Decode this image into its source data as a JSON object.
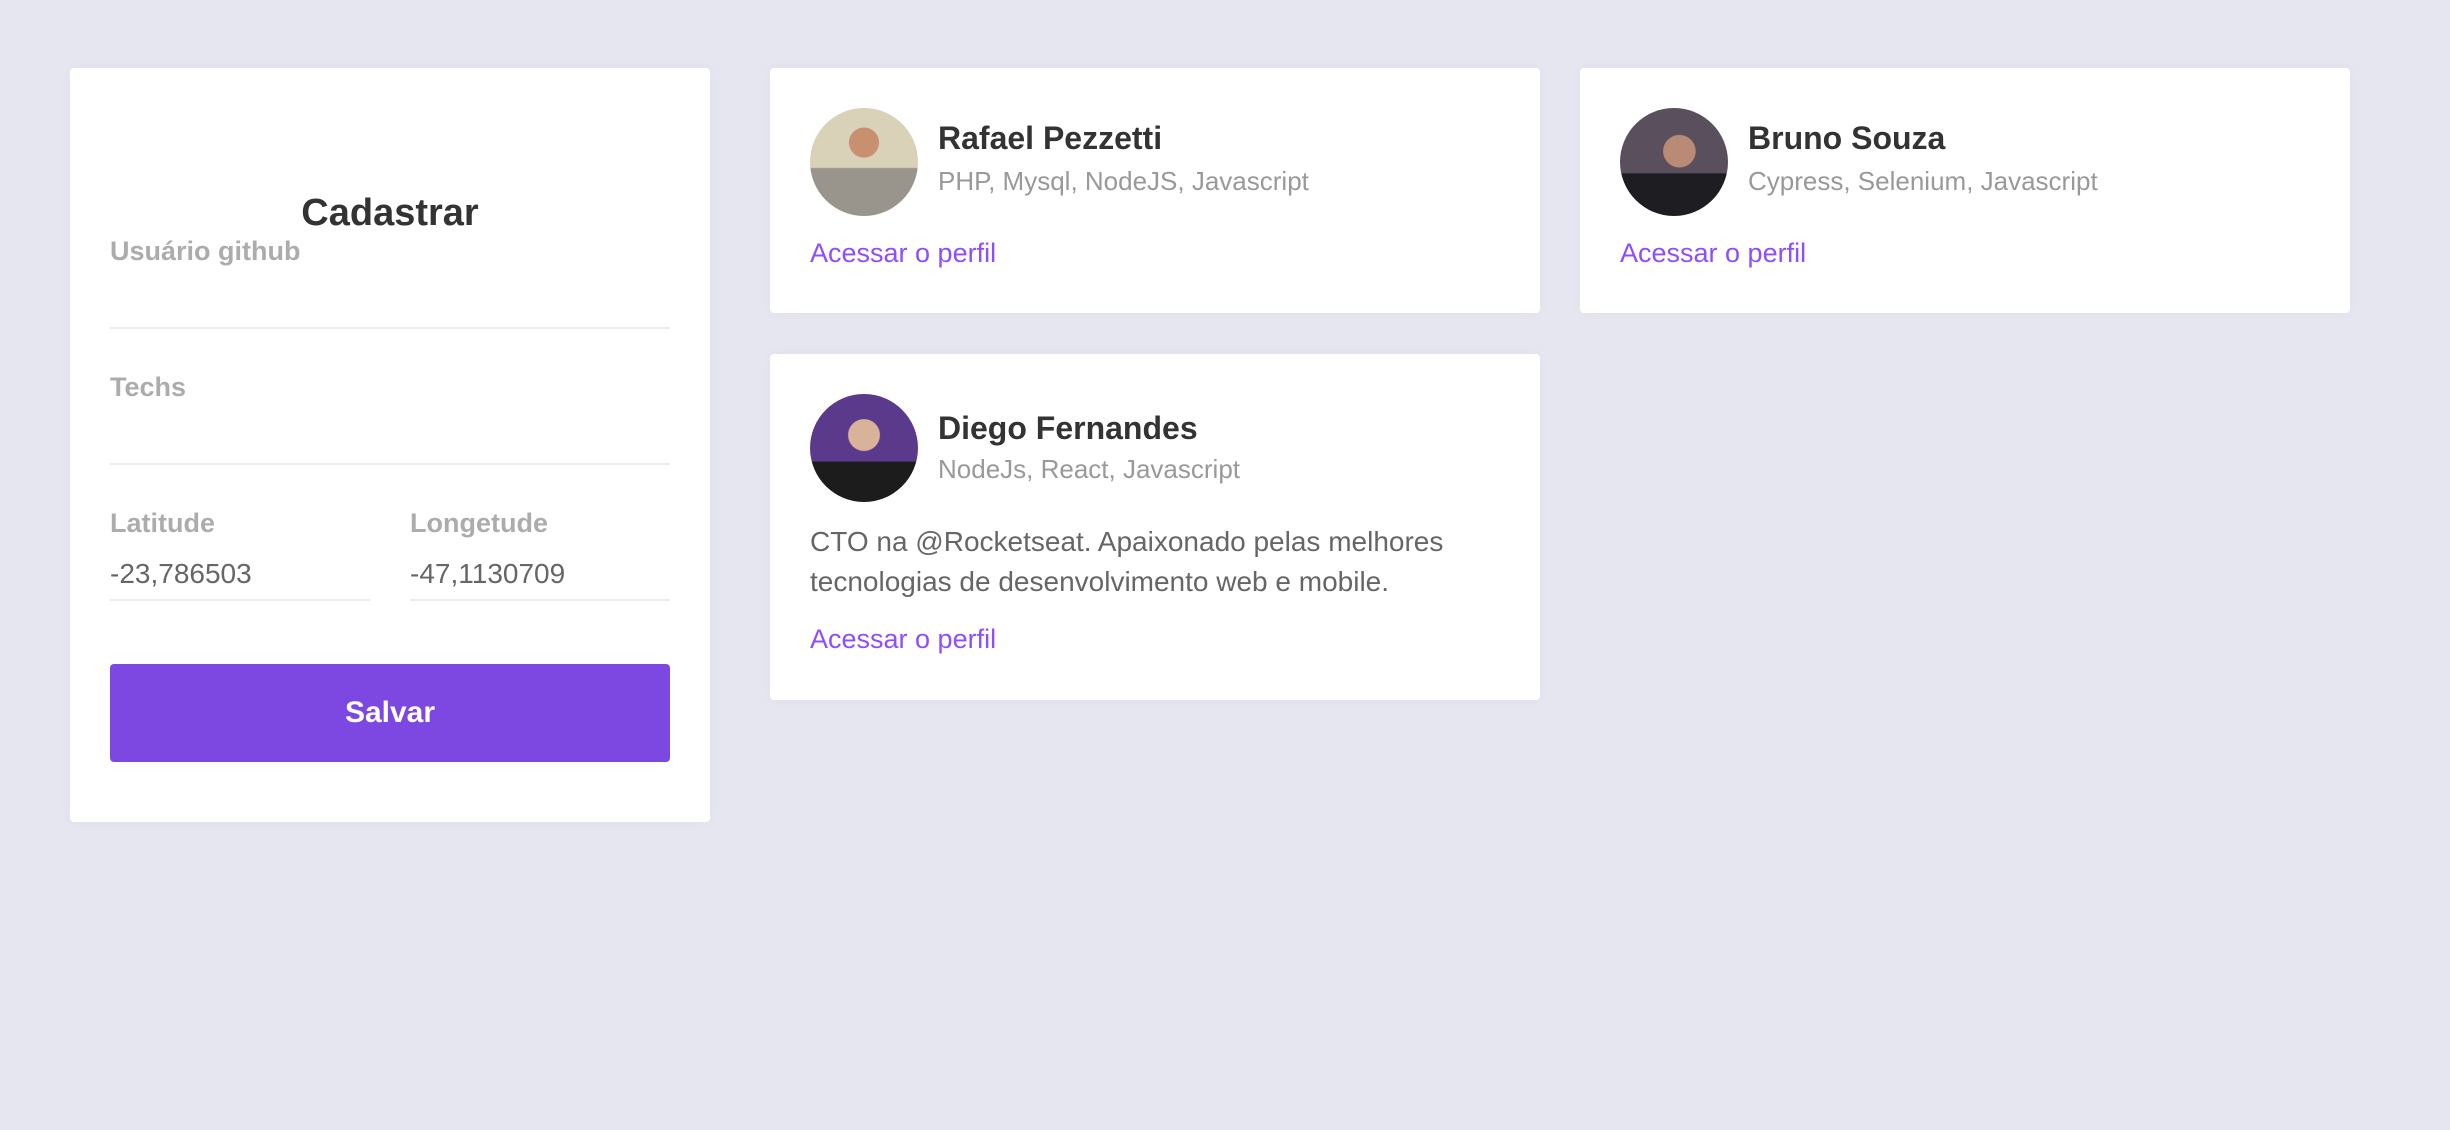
{
  "form": {
    "title": "Cadastrar",
    "github_user": {
      "label": "Usuário github",
      "value": ""
    },
    "techs": {
      "label": "Techs",
      "value": ""
    },
    "latitude": {
      "label": "Latitude",
      "value": "-23,786503"
    },
    "longitude": {
      "label": "Longetude",
      "value": "-47,1130709"
    },
    "save_label": "Salvar"
  },
  "devs": [
    {
      "name": "Rafael Pezzetti",
      "techs": "PHP, Mysql, NodeJS, Javascript",
      "bio": "",
      "link": "Acessar o perfil"
    },
    {
      "name": "Bruno Souza",
      "techs": "Cypress, Selenium, Javascript",
      "bio": "",
      "link": "Acessar o perfil"
    },
    {
      "name": "Diego Fernandes",
      "techs": "NodeJs, React, Javascript",
      "bio": "CTO na @Rocketseat. Apaixonado pelas melhores tecnologias de desenvolvimento web e mobile.",
      "link": "Acessar o perfil"
    }
  ],
  "colors": {
    "accent": "#7d48e2",
    "link": "#8e4dff",
    "background": "#e5e6f0"
  }
}
